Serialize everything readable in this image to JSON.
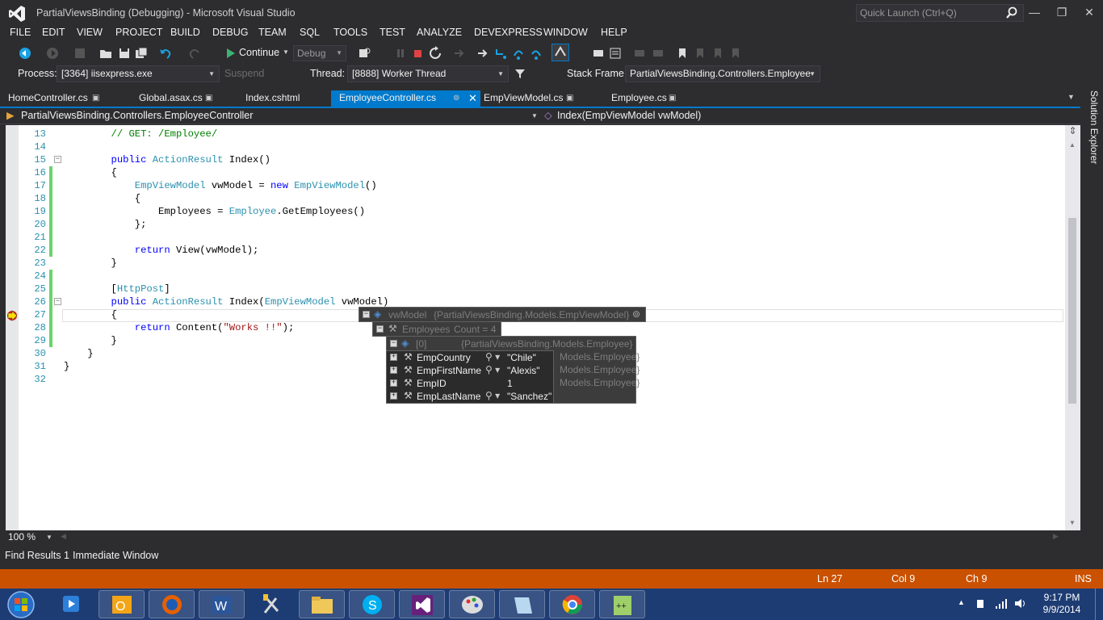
{
  "window": {
    "title": "PartialViewsBinding (Debugging) - Microsoft Visual Studio",
    "quick_launch_placeholder": "Quick Launch (Ctrl+Q)"
  },
  "menu": [
    "FILE",
    "EDIT",
    "VIEW",
    "PROJECT",
    "BUILD",
    "DEBUG",
    "TEAM",
    "SQL",
    "TOOLS",
    "TEST",
    "ANALYZE",
    "DEVEXPRESS",
    "WINDOW",
    "HELP"
  ],
  "toolbar": {
    "continue_label": "Continue",
    "config_value": "Debug"
  },
  "debug_location": {
    "process_label": "Process:",
    "process_value": "[3364] iisexpress.exe",
    "suspend_label": "Suspend",
    "thread_label": "Thread:",
    "thread_value": "[8888] Worker Thread",
    "stack_frame_label": "Stack Frame:",
    "stack_frame_value": "PartialViewsBinding.Controllers.Employee"
  },
  "tabs": [
    {
      "label": "HomeController.cs"
    },
    {
      "label": "Global.asax.cs"
    },
    {
      "label": "Index.cshtml"
    },
    {
      "label": "EmployeeController.cs",
      "active": true
    },
    {
      "label": "EmpViewModel.cs"
    },
    {
      "label": "Employee.cs"
    }
  ],
  "nav": {
    "class_value": "PartialViewsBinding.Controllers.EmployeeController",
    "member_value": "Index(EmpViewModel vwModel)"
  },
  "solution_explorer_label": "Solution Explorer",
  "zoom": "100 %",
  "code_lines": [
    {
      "n": "13",
      "text": "        // GET: /Employee/"
    },
    {
      "n": "14",
      "text": ""
    },
    {
      "n": "15",
      "text": "        public ActionResult Index()"
    },
    {
      "n": "16",
      "text": "        {"
    },
    {
      "n": "17",
      "text": "            EmpViewModel vwModel = new EmpViewModel()"
    },
    {
      "n": "18",
      "text": "            {"
    },
    {
      "n": "19",
      "text": "                Employees = Employee.GetEmployees()"
    },
    {
      "n": "20",
      "text": "            };"
    },
    {
      "n": "21",
      "text": ""
    },
    {
      "n": "22",
      "text": "            return View(vwModel);"
    },
    {
      "n": "23",
      "text": "        }"
    },
    {
      "n": "24",
      "text": ""
    },
    {
      "n": "25",
      "text": "        [HttpPost]"
    },
    {
      "n": "26",
      "text": "        public ActionResult Index(EmpViewModel vwModel)"
    },
    {
      "n": "27",
      "text": "        {"
    },
    {
      "n": "28",
      "text": "            return Content(\"Works !!\");"
    },
    {
      "n": "29",
      "text": "        }"
    },
    {
      "n": "30",
      "text": "    }"
    },
    {
      "n": "31",
      "text": "}"
    },
    {
      "n": "32",
      "text": ""
    }
  ],
  "datatip": {
    "root_name": "vwModel",
    "root_value": "{PartialViewsBinding.Models.EmpViewModel}",
    "child_name": "Employees",
    "child_value": "Count = 4",
    "item_index": "[0]",
    "item_type": "{PartialViewsBinding.Models.Employee}",
    "hidden_type_suffix": "Models.Employee}",
    "props": [
      {
        "name": "EmpCountry",
        "value": "\"Chile\""
      },
      {
        "name": "EmpFirstName",
        "value": "\"Alexis\""
      },
      {
        "name": "EmpID",
        "value": "1"
      },
      {
        "name": "EmpLastName",
        "value": "\"Sanchez\""
      }
    ]
  },
  "bottom_tabs": [
    "Find Results 1",
    "Immediate Window"
  ],
  "status": {
    "ln": "Ln 27",
    "col": "Col 9",
    "ch": "Ch 9",
    "ins": "INS"
  },
  "clock": {
    "time": "9:17 PM",
    "date": "9/9/2014"
  },
  "colors": {
    "status_bar": "#ca5100",
    "accent": "#007acc",
    "taskbar": "#1d3c73"
  }
}
